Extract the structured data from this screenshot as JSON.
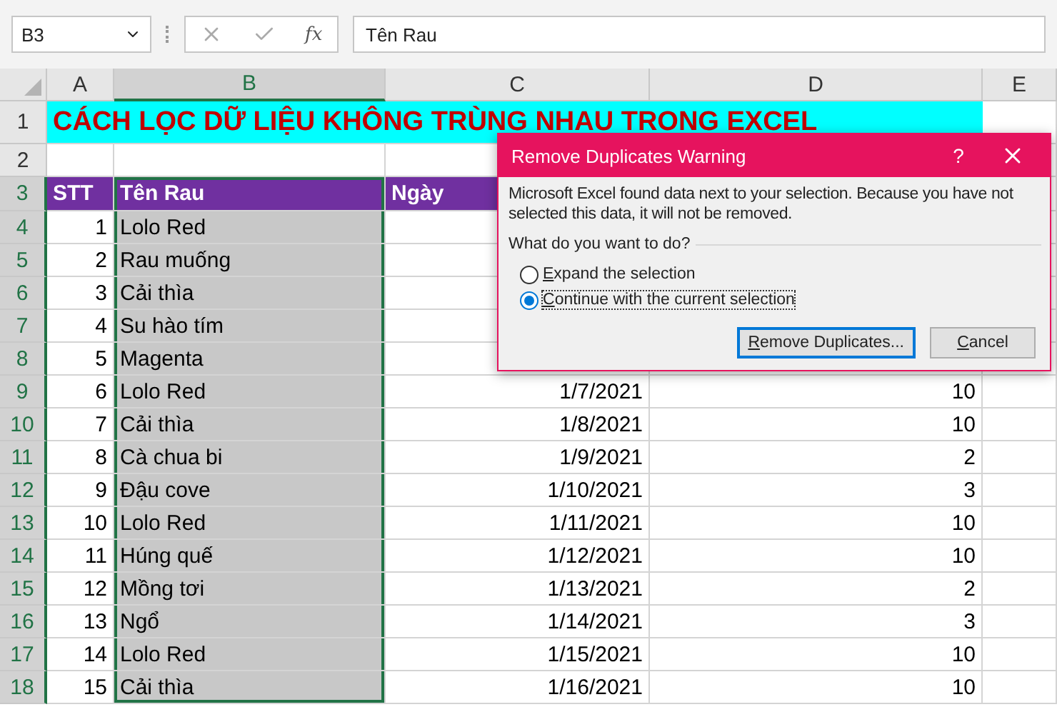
{
  "formula_bar": {
    "name_box": "B3",
    "fx": "fx",
    "value": "Tên Rau"
  },
  "columns": [
    {
      "label": "A",
      "selected": false
    },
    {
      "label": "B",
      "selected": true
    },
    {
      "label": "C",
      "selected": false
    },
    {
      "label": "D",
      "selected": false
    },
    {
      "label": "E",
      "selected": false
    }
  ],
  "title_row": {
    "row": "1",
    "text": "CÁCH LỌC DỮ LIỆU KHÔNG TRÙNG NHAU TRONG EXCEL"
  },
  "empty_row": {
    "row": "2"
  },
  "header_row": {
    "row": "3",
    "cells": [
      "STT",
      "Tên Rau",
      "Ngày"
    ]
  },
  "rows": [
    {
      "row": "4",
      "stt": "1",
      "name": "Lolo Red"
    },
    {
      "row": "5",
      "stt": "2",
      "name": "Rau muống"
    },
    {
      "row": "6",
      "stt": "3",
      "name": "Cải thìa"
    },
    {
      "row": "7",
      "stt": "4",
      "name": "Su hào tím"
    },
    {
      "row": "8",
      "stt": "5",
      "name": "Magenta"
    },
    {
      "row": "9",
      "stt": "6",
      "name": "Lolo Red",
      "date": "1/7/2021",
      "qty": "10"
    },
    {
      "row": "10",
      "stt": "7",
      "name": "Cải thìa",
      "date": "1/8/2021",
      "qty": "10"
    },
    {
      "row": "11",
      "stt": "8",
      "name": "Cà chua bi",
      "date": "1/9/2021",
      "qty": "2"
    },
    {
      "row": "12",
      "stt": "9",
      "name": "Đậu cove",
      "date": "1/10/2021",
      "qty": "3"
    },
    {
      "row": "13",
      "stt": "10",
      "name": "Lolo Red",
      "date": "1/11/2021",
      "qty": "10"
    },
    {
      "row": "14",
      "stt": "11",
      "name": "Húng quế",
      "date": "1/12/2021",
      "qty": "10"
    },
    {
      "row": "15",
      "stt": "12",
      "name": "Mồng tơi",
      "date": "1/13/2021",
      "qty": "2"
    },
    {
      "row": "16",
      "stt": "13",
      "name": "Ngổ",
      "date": "1/14/2021",
      "qty": "3"
    },
    {
      "row": "17",
      "stt": "14",
      "name": "Lolo Red",
      "date": "1/15/2021",
      "qty": "10"
    },
    {
      "row": "18",
      "stt": "15",
      "name": "Cải thìa",
      "date": "1/16/2021",
      "qty": "10"
    }
  ],
  "dialog": {
    "title": "Remove Duplicates Warning",
    "help": "?",
    "message": "Microsoft Excel found data next to your selection. Because you have not selected this data, it will not be removed.",
    "question": "What do you want to do?",
    "options": [
      {
        "label": "Expand the selection",
        "selected": false
      },
      {
        "label": "Continue with the current selection",
        "selected": true
      }
    ],
    "buttons": [
      {
        "label": "Remove Duplicates...",
        "default": true
      },
      {
        "label": "Cancel",
        "default": false
      }
    ]
  }
}
